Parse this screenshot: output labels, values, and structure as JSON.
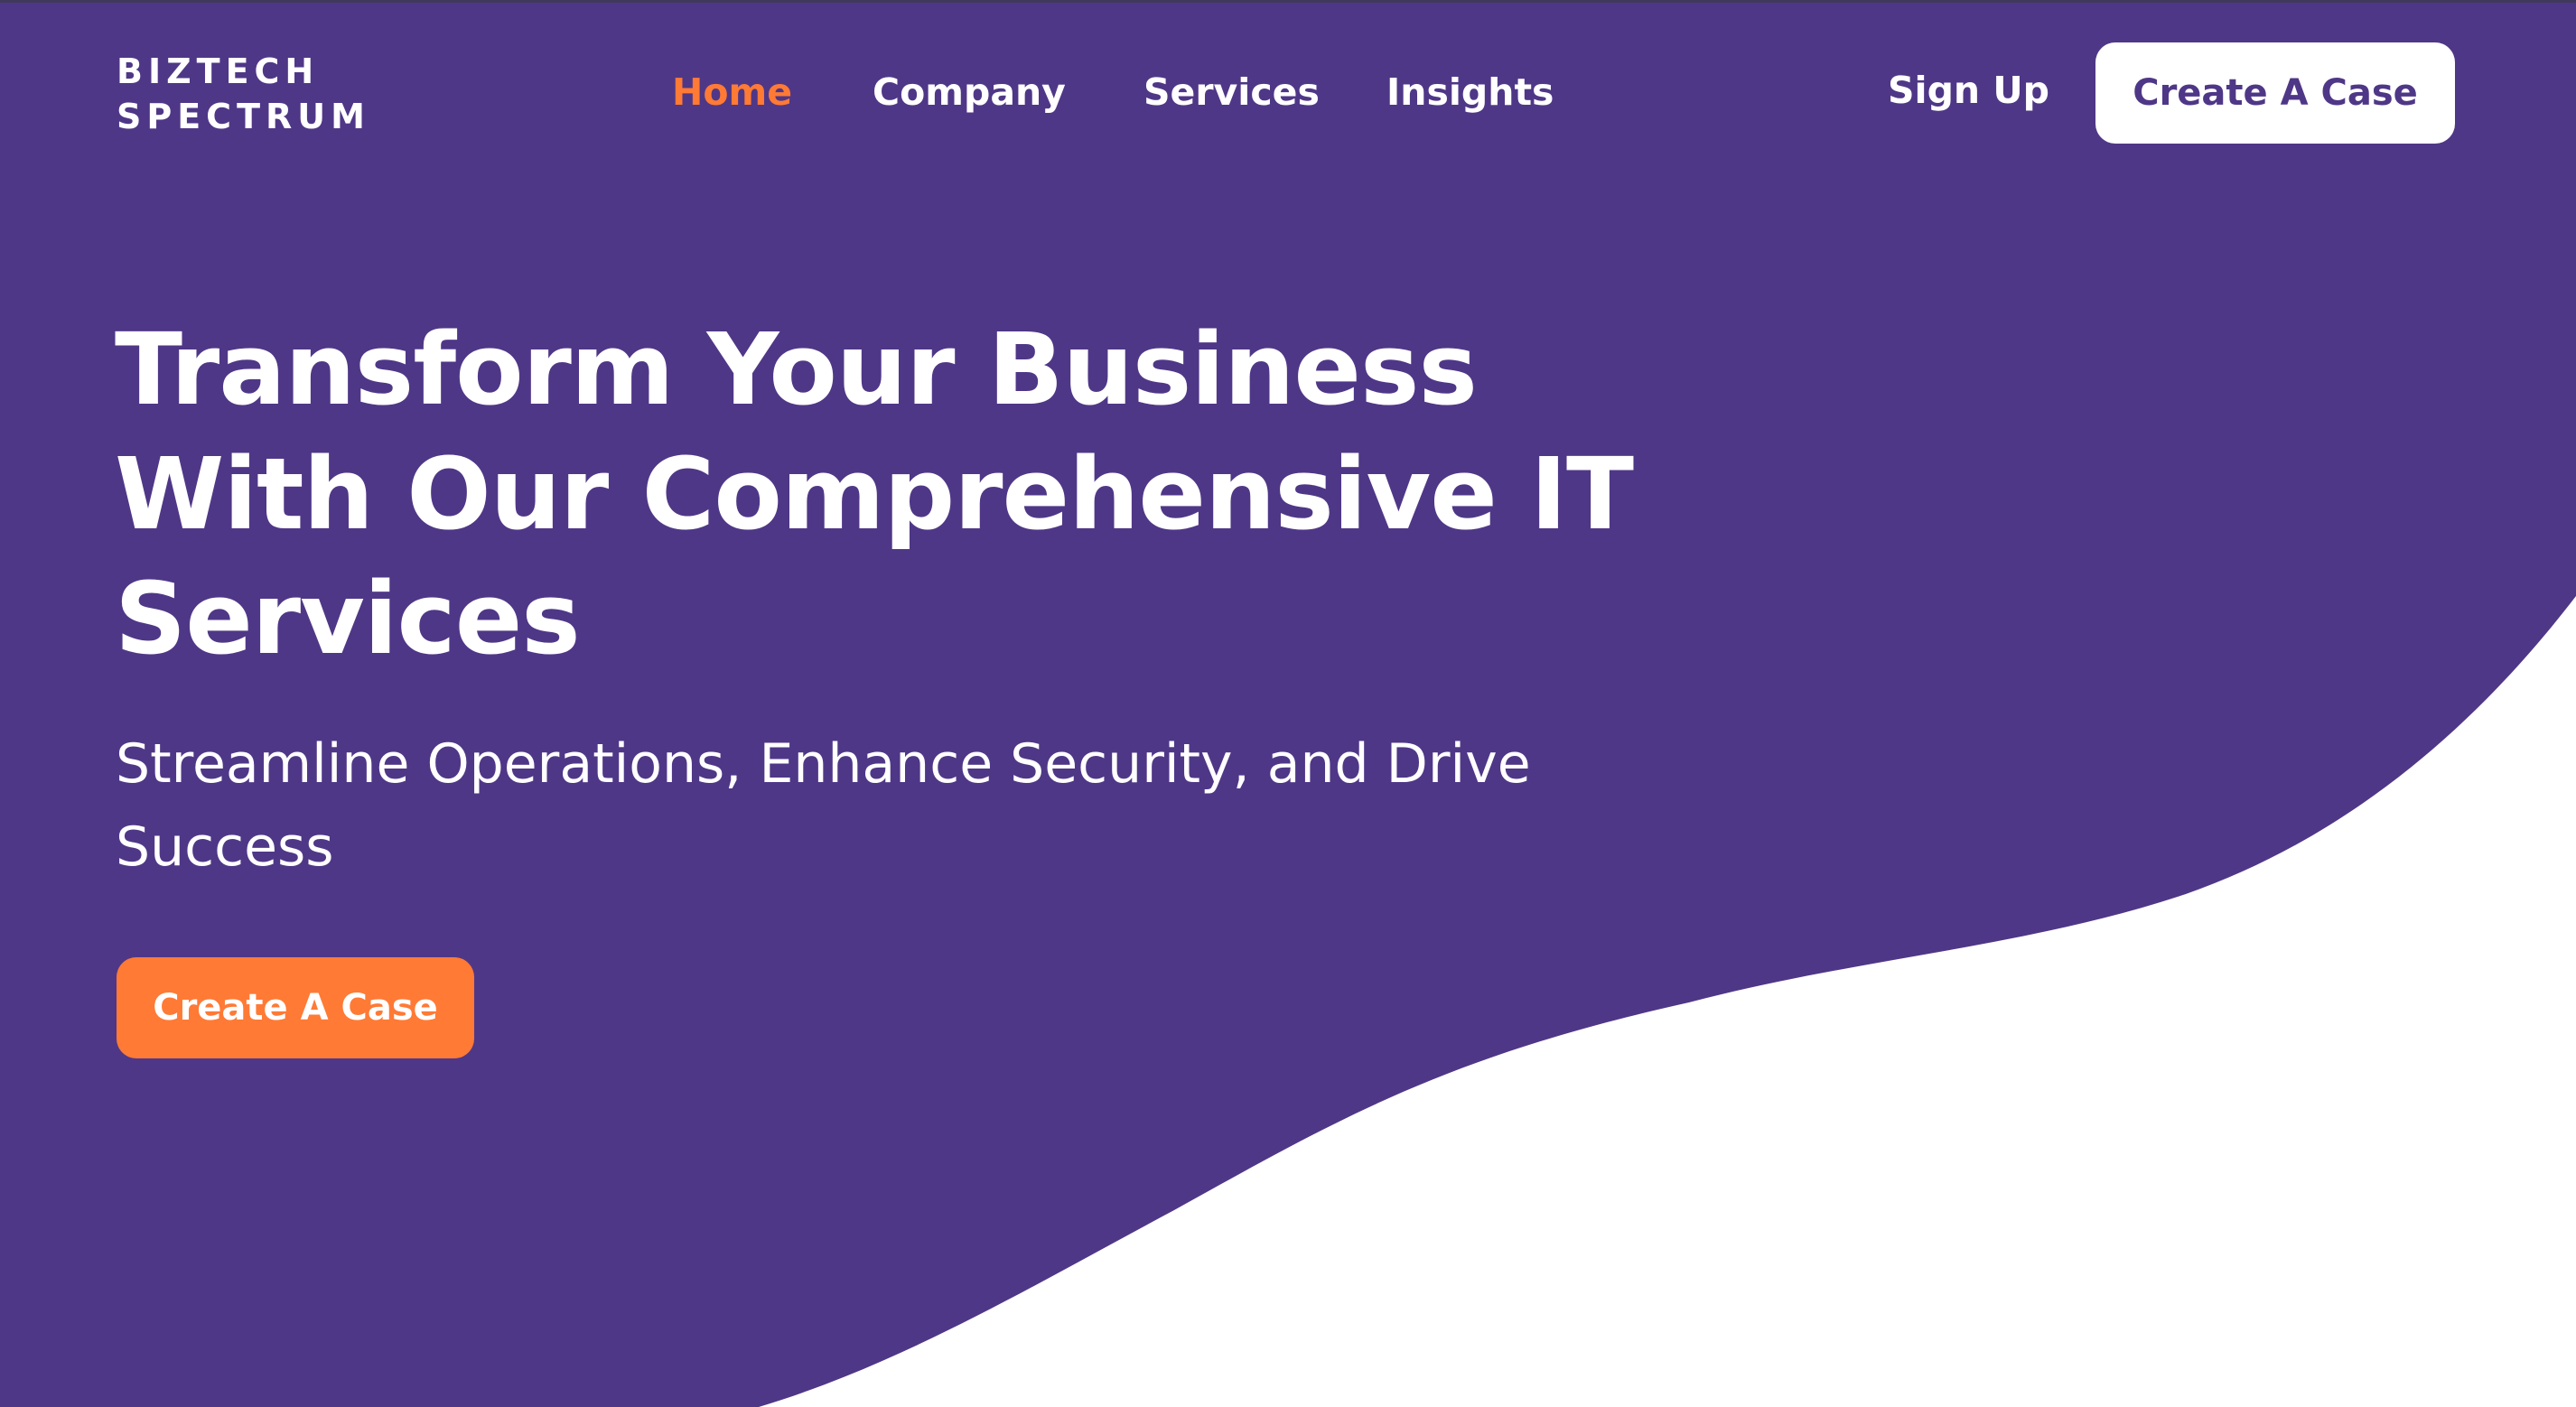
{
  "brand": {
    "line1": "BIZTECH",
    "line2": "SPECTRUM"
  },
  "nav": {
    "items": [
      {
        "label": "Home",
        "active": true
      },
      {
        "label": "Company",
        "active": false
      },
      {
        "label": "Services",
        "active": false
      },
      {
        "label": "Insights",
        "active": false
      }
    ]
  },
  "header": {
    "signup_label": "Sign Up",
    "cta_label": "Create A Case"
  },
  "hero": {
    "title_lines": [
      "Transform Your Business",
      "With Our Comprehensive IT",
      "Services"
    ],
    "subtitle": "Streamline Operations, Enhance Security, and Drive Success",
    "cta_label": "Create A Case"
  },
  "colors": {
    "primary_purple": "#4f3787",
    "accent_orange": "#ff7a35",
    "text_white": "#ffffff",
    "background_white": "#ffffff"
  }
}
